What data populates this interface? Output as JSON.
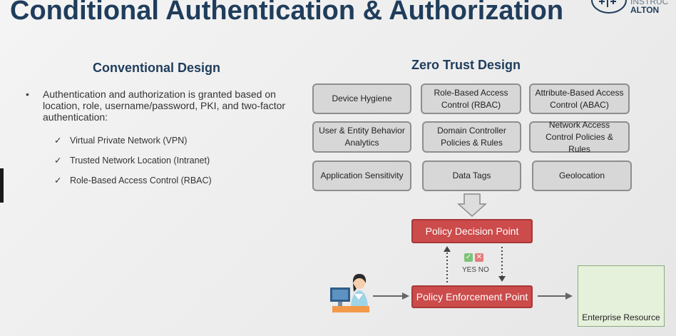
{
  "title": "Conditional Authentication & Authorization",
  "logo": {
    "line1": "INSTRUC",
    "line2": "ALTON"
  },
  "conventional": {
    "heading": "Conventional Design",
    "bullet": "Authentication and authorization is granted based on location, role, username/password, PKI, and two-factor authentication:",
    "checks": [
      "Virtual Private Network (VPN)",
      "Trusted Network Location (Intranet)",
      "Role-Based Access Control (RBAC)"
    ]
  },
  "zero_trust": {
    "heading": "Zero Trust Design",
    "factors": [
      "Device Hygiene",
      "Role-Based Access Control (RBAC)",
      "Attribute-Based Access Control (ABAC)",
      "User & Entity Behavior Analytics",
      "Domain Controller Policies & Rules",
      "Network Access Control Policies & Rules",
      "Application Sensitivity",
      "Data Tags",
      "Geolocation"
    ],
    "pdp": "Policy Decision  Point",
    "pep": "Policy Enforcement Point",
    "yes_no": "YES NO",
    "resource": "Enterprise Resource"
  },
  "colors": {
    "title": "#1f3d5c",
    "factor_box": "#d7d7d7",
    "policy_box": "#cc4b4b",
    "resource_box": "#e6f1dc"
  },
  "icons": [
    "user-at-computer-icon",
    "server-database-icon",
    "check-icon",
    "cross-icon"
  ]
}
